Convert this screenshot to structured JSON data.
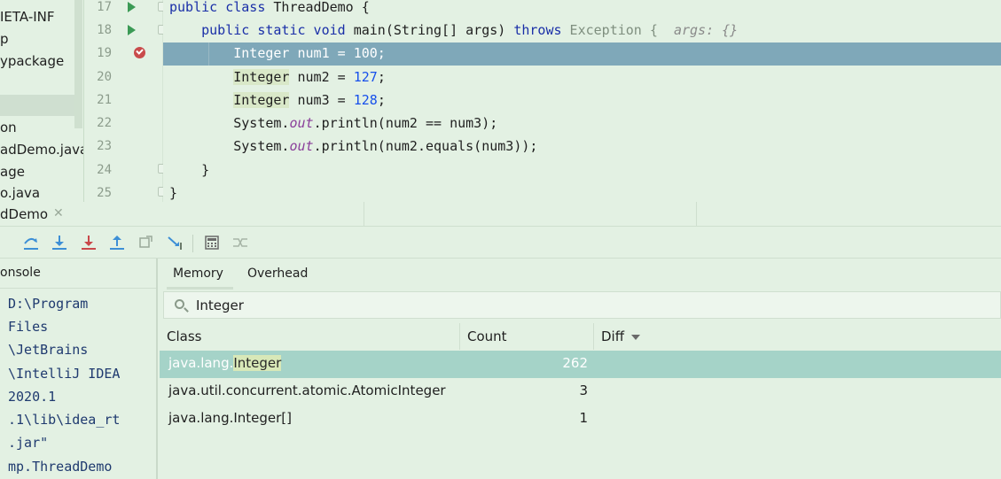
{
  "project_tree": {
    "items": [
      "IETA-INF",
      "p",
      "ypackage",
      "on",
      "adDemo.java",
      "age",
      "o.java"
    ]
  },
  "editor": {
    "line_numbers": [
      "17",
      "18",
      "19",
      "20",
      "21",
      "22",
      "23",
      "24",
      "25"
    ],
    "lines": {
      "l17": {
        "kw": "public class",
        "rest": " ThreadDemo {"
      },
      "l18": {
        "kw1": "public static void",
        "name": " main",
        "args": "(String[] args) ",
        "kw2": "throws",
        "exc": " Exception {  ",
        "hint": "args: {}"
      },
      "l19": {
        "text": "    Integer num1 = 100;"
      },
      "l20": {
        "type": "Integer",
        "mid": " num2 = ",
        "num": "127",
        "end": ";"
      },
      "l21": {
        "type": "Integer",
        "mid": " num3 = ",
        "num": "128",
        "end": ";"
      },
      "l22": {
        "pre": "System.",
        "field": "out",
        "post": ".println(num2 == num3);"
      },
      "l23": {
        "pre": "System.",
        "field": "out",
        "post": ".println(num2.equals(num3));"
      },
      "l24": {
        "text": "}"
      },
      "l25": {
        "text": "}"
      }
    }
  },
  "debug_tab": {
    "label": "dDemo",
    "close": "✕"
  },
  "toolbar": {
    "icons": [
      "console-icon",
      "step-over-icon",
      "step-into-icon",
      "force-step-into-icon",
      "step-out-icon",
      "drop-frame-icon",
      "run-to-cursor-icon",
      "evaluate-expression-icon",
      "trace-icon"
    ]
  },
  "console": {
    "header": "onsole",
    "lines": [
      "D:\\Program",
      "Files",
      "\\JetBrains",
      "\\IntelliJ IDEA",
      " 2020.1",
      ".1\\lib\\idea_rt",
      ".jar\"",
      "mp.ThreadDemo"
    ]
  },
  "memory": {
    "tabs": [
      "Memory",
      "Overhead"
    ],
    "search_value": "Integer",
    "columns": {
      "class": "Class",
      "count": "Count",
      "diff": "Diff"
    },
    "rows": [
      {
        "class_prefix": "java.lang.",
        "class_match": "Integer",
        "count": "262"
      },
      {
        "class": "java.util.concurrent.atomic.AtomicInteger",
        "count": "3"
      },
      {
        "class": "java.lang.Integer[]",
        "count": "1"
      }
    ]
  }
}
